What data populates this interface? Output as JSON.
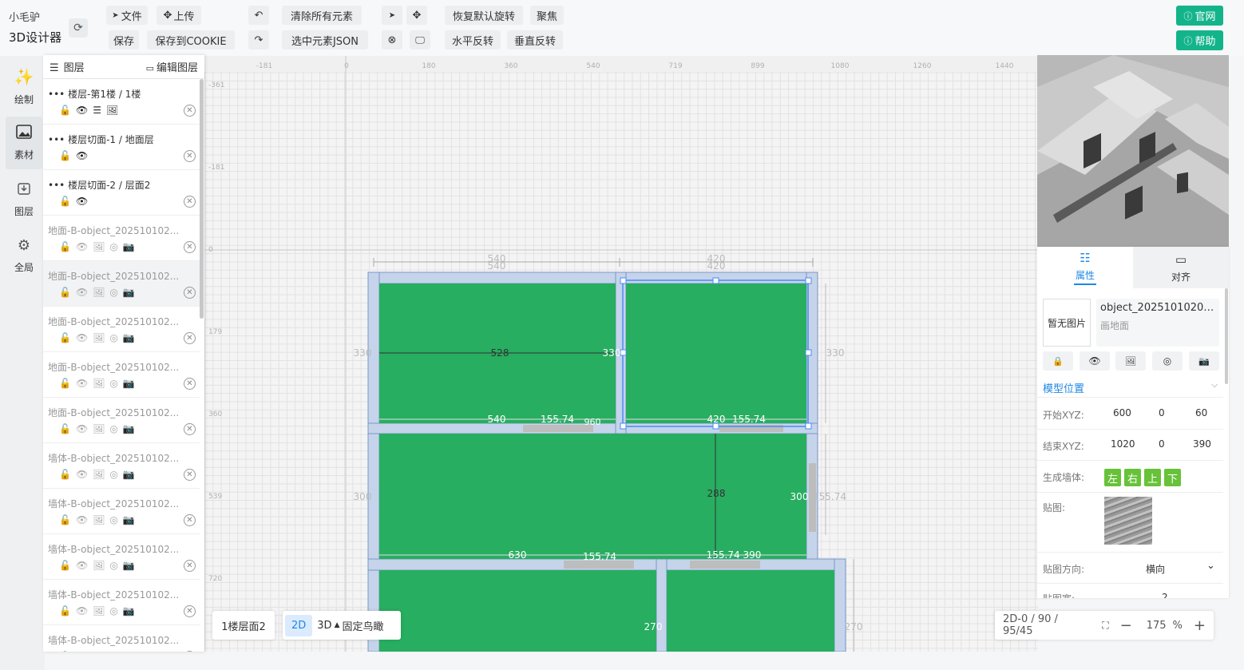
{
  "brand": {
    "name": "小毛驴",
    "subtitle": "3D设计器"
  },
  "toolbar": {
    "file": "文件",
    "upload": "上传",
    "save": "保存",
    "save_cookie": "保存到COOKIE",
    "clear_all": "清除所有元素",
    "selected_json": "选中元素JSON",
    "reset_rotation": "恢复默认旋转",
    "focus": "聚焦",
    "flip_h": "水平反转",
    "flip_v": "垂直反转",
    "official_site": "官网",
    "help": "帮助"
  },
  "nav": {
    "draw": "绘制",
    "material": "素材",
    "layers": "图层",
    "global": "全局"
  },
  "layer_panel": {
    "title": "图层",
    "edit": "编辑图层",
    "items": [
      {
        "label": "楼层-第1楼 / 1楼"
      },
      {
        "label": "楼层切面-1 / 地面层"
      },
      {
        "label": "楼层切面-2 / 层面2"
      },
      {
        "label": "地面-B-object_202510102..."
      },
      {
        "label": "地面-B-object_202510102..."
      },
      {
        "label": "地面-B-object_202510102..."
      },
      {
        "label": "地面-B-object_202510102..."
      },
      {
        "label": "地面-B-object_202510102..."
      },
      {
        "label": "墙体-B-object_202510102..."
      },
      {
        "label": "墙体-B-object_202510102..."
      },
      {
        "label": "墙体-B-object_202510102..."
      },
      {
        "label": "墙体-B-object_202510102..."
      },
      {
        "label": "墙体-B-object_202510102..."
      }
    ]
  },
  "ruler": {
    "x_ticks": [
      "-181",
      "0",
      "180",
      "360",
      "540",
      "719",
      "899",
      "1080",
      "1260",
      "1440"
    ],
    "y_ticks": [
      "-361",
      "-181",
      "0",
      "179",
      "360",
      "539",
      "720"
    ]
  },
  "plan": {
    "dims": [
      "540",
      "540",
      "420",
      "420",
      "330",
      "528",
      "330",
      "330",
      "540",
      "155.74",
      "960",
      "420",
      "155.74",
      "300",
      "288",
      "300",
      "155.74",
      "630",
      "155.74",
      "155.74 390",
      "270",
      "270"
    ]
  },
  "props": {
    "tab_attr": "属性",
    "tab_align": "对齐",
    "no_image": "暂无图片",
    "object_name": "object_20251010204...",
    "object_type": "画地面",
    "section_model_position": "模型位置",
    "start_label": "开始XYZ:",
    "start": [
      "600",
      "0",
      "60"
    ],
    "end_label": "结束XYZ:",
    "end": [
      "1020",
      "0",
      "390"
    ],
    "gen_wall_label": "生成墙体:",
    "gen_wall": [
      "左",
      "右",
      "上",
      "下"
    ],
    "texture_label": "贴图:",
    "texture_dir_label": "贴图方向:",
    "texture_dir": "横向",
    "cut_label": "贴图宽:",
    "cut_value": "2"
  },
  "bottom": {
    "floor": "1楼层面2",
    "mode_2d": "2D",
    "mode_3d": "3D",
    "birdview": "固定鸟瞰",
    "status": "2D-0 / 90 / 95/45",
    "zoom": "175",
    "zoom_unit": "%"
  },
  "colors": {
    "accent": "#14b48b",
    "room": "#27ae60",
    "wall": "#c5d4ea",
    "wall_stroke": "#7a96c8",
    "select": "#4a8af4",
    "link": "#1e88e5",
    "dir_btn": "#67c23a"
  }
}
